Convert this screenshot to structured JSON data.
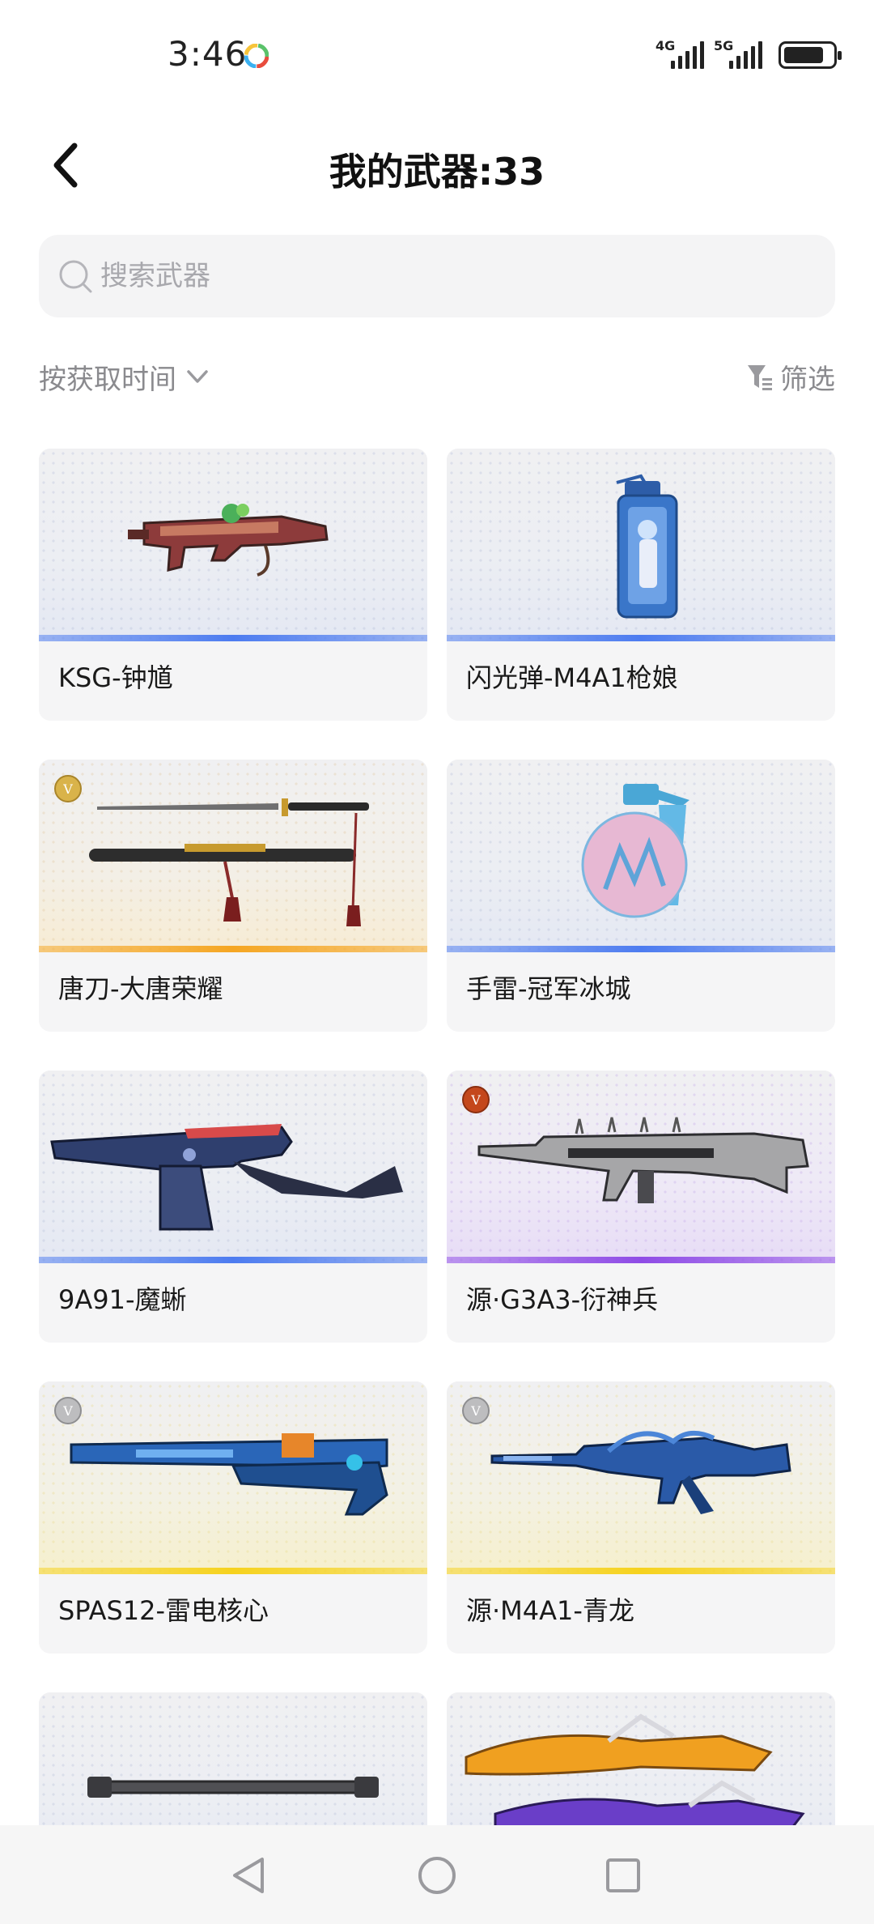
{
  "status_bar": {
    "time": "3:46",
    "network_1": "4G",
    "network_2": "5G"
  },
  "header": {
    "title": "我的武器:33"
  },
  "search": {
    "placeholder": "搜索武器",
    "value": ""
  },
  "toolbar": {
    "sort_label": "按获取时间",
    "filter_label": "筛选"
  },
  "colors": {
    "rarity_blue": "#4d7cf0",
    "rarity_gold": "#f5a623",
    "rarity_purple": "#8f4ce6",
    "rarity_yellow": "#f6d21e"
  },
  "weapons": [
    {
      "name": "KSG-钟馗",
      "rarity": "blue",
      "badge": ""
    },
    {
      "name": "闪光弹-M4A1枪娘",
      "rarity": "blue",
      "badge": ""
    },
    {
      "name": "唐刀-大唐荣耀",
      "rarity": "gold",
      "badge": "V"
    },
    {
      "name": "手雷-冠军冰城",
      "rarity": "blue",
      "badge": ""
    },
    {
      "name": "9A91-魔蜥",
      "rarity": "blue",
      "badge": ""
    },
    {
      "name": "源·G3A3-衍神兵",
      "rarity": "purple",
      "badge": "V"
    },
    {
      "name": "SPAS12-雷电核心",
      "rarity": "yellow",
      "badge": "V"
    },
    {
      "name": "源·M4A1-青龙",
      "rarity": "yellow",
      "badge": "V"
    },
    {
      "name": "",
      "rarity": "",
      "badge": ""
    },
    {
      "name": "",
      "rarity": "",
      "badge": ""
    }
  ]
}
